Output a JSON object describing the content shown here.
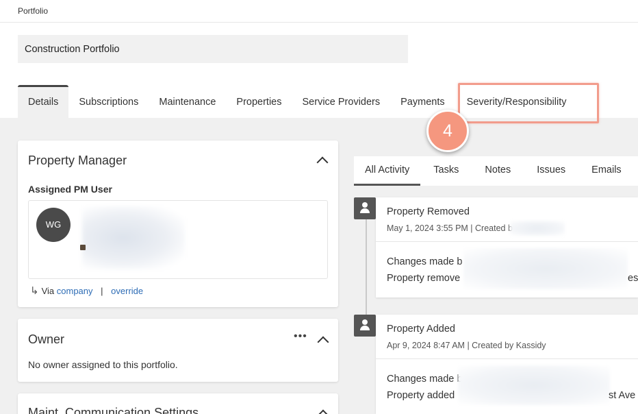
{
  "breadcrumb": "Portfolio",
  "portfolio": {
    "name": "Construction Portfolio"
  },
  "tabs": [
    {
      "label": "Details"
    },
    {
      "label": "Subscriptions"
    },
    {
      "label": "Maintenance"
    },
    {
      "label": "Properties"
    },
    {
      "label": "Service Providers"
    },
    {
      "label": "Payments"
    },
    {
      "label": "Severity/Responsibility"
    }
  ],
  "step_number": "4",
  "colors": {
    "highlight": "#f29c8c",
    "badge": "#f5977f",
    "link": "#2d6cb5"
  },
  "property_manager": {
    "title": "Property Manager",
    "assigned_label": "Assigned PM User",
    "avatar_initials": "WG",
    "via_label": "Via",
    "via_company": "company",
    "separator": "|",
    "via_override": "override"
  },
  "owner": {
    "title": "Owner",
    "more_label": "•••",
    "empty_text": "No owner assigned to this portfolio."
  },
  "maint": {
    "title": "Maint. Communication Settings"
  },
  "activity": {
    "tabs": [
      {
        "label": "All Activity"
      },
      {
        "label": "Tasks"
      },
      {
        "label": "Notes"
      },
      {
        "label": "Issues"
      },
      {
        "label": "Emails"
      }
    ],
    "items": [
      {
        "title": "Property Removed",
        "meta": "May 1, 2024 3:55 PM | Created b",
        "line1": "Changes made b",
        "line2": "Property remove",
        "line2_tail": "es"
      },
      {
        "title": "Property Added",
        "meta": "Apr 9, 2024 8:47 AM | Created by Kassidy",
        "line1": "Changes made b",
        "line2": "Property added",
        "line2_tail": "st Ave"
      }
    ]
  }
}
